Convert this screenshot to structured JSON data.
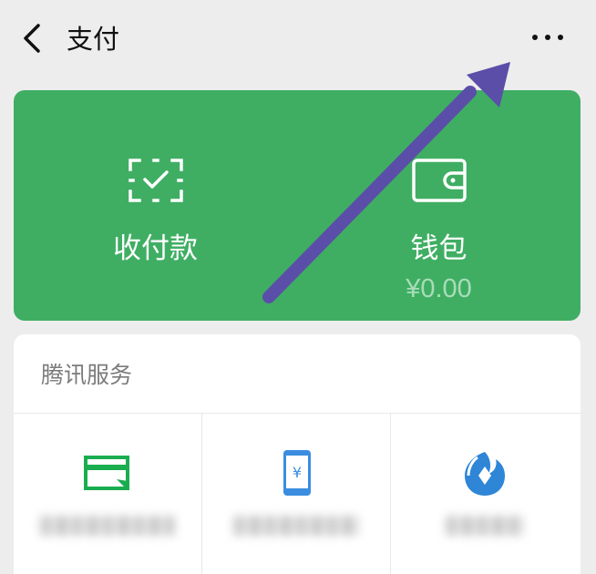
{
  "header": {
    "title": "支付",
    "back_icon": "chevron-left-icon",
    "more_icon": "more-dots-icon"
  },
  "card": {
    "color": "#3fae63",
    "items": [
      {
        "label": "收付款",
        "icon": "scan-check-icon"
      },
      {
        "label": "钱包",
        "icon": "wallet-icon",
        "balance": "¥0.00"
      }
    ]
  },
  "services": {
    "title": "腾讯服务",
    "items": [
      {
        "icon": "card-icon",
        "color": "#1aad4f",
        "label": ""
      },
      {
        "icon": "phone-yuan-icon",
        "color": "#3b8de0",
        "label": ""
      },
      {
        "icon": "wealth-drop-icon",
        "color": "#2f86d6",
        "label": ""
      }
    ]
  },
  "annotation": {
    "arrow_color": "#5b4ea8"
  }
}
